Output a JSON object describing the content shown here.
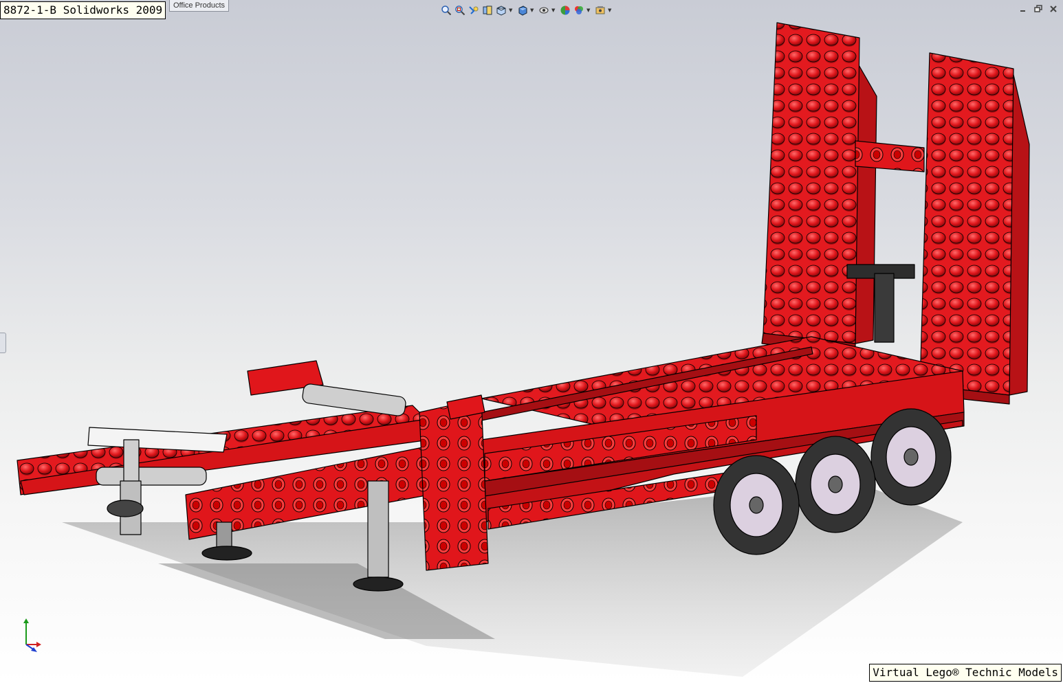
{
  "window": {
    "title_caption": "8872-1-B Solidworks 2009",
    "footer_caption": "Virtual Lego® Technic Models",
    "office_tab": "Office Products"
  },
  "toolbar": {
    "items": [
      {
        "icon": "zoom-to-fit-icon",
        "dropdown": false
      },
      {
        "icon": "zoom-to-area-icon",
        "dropdown": false
      },
      {
        "icon": "previous-view-icon",
        "dropdown": false
      },
      {
        "icon": "section-view-icon",
        "dropdown": false
      },
      {
        "icon": "view-orientation-icon",
        "dropdown": true
      },
      {
        "icon": "display-style-icon",
        "dropdown": true
      },
      {
        "icon": "hide-show-items-icon",
        "dropdown": true
      },
      {
        "icon": "edit-appearance-icon",
        "dropdown": false
      },
      {
        "icon": "apply-scene-icon",
        "dropdown": true
      },
      {
        "icon": "view-settings-icon",
        "dropdown": true
      }
    ]
  },
  "window_controls": [
    "minimize-icon",
    "restore-icon",
    "close-icon"
  ],
  "colors": {
    "brick_red": "#e0161b",
    "brick_dark": "#9b0d10",
    "brick_light": "#f0494c",
    "outline": "#000000",
    "tire": "#3a3a3a",
    "hub": "#d8c8dc",
    "axle_grey": "#c8c8c8"
  }
}
